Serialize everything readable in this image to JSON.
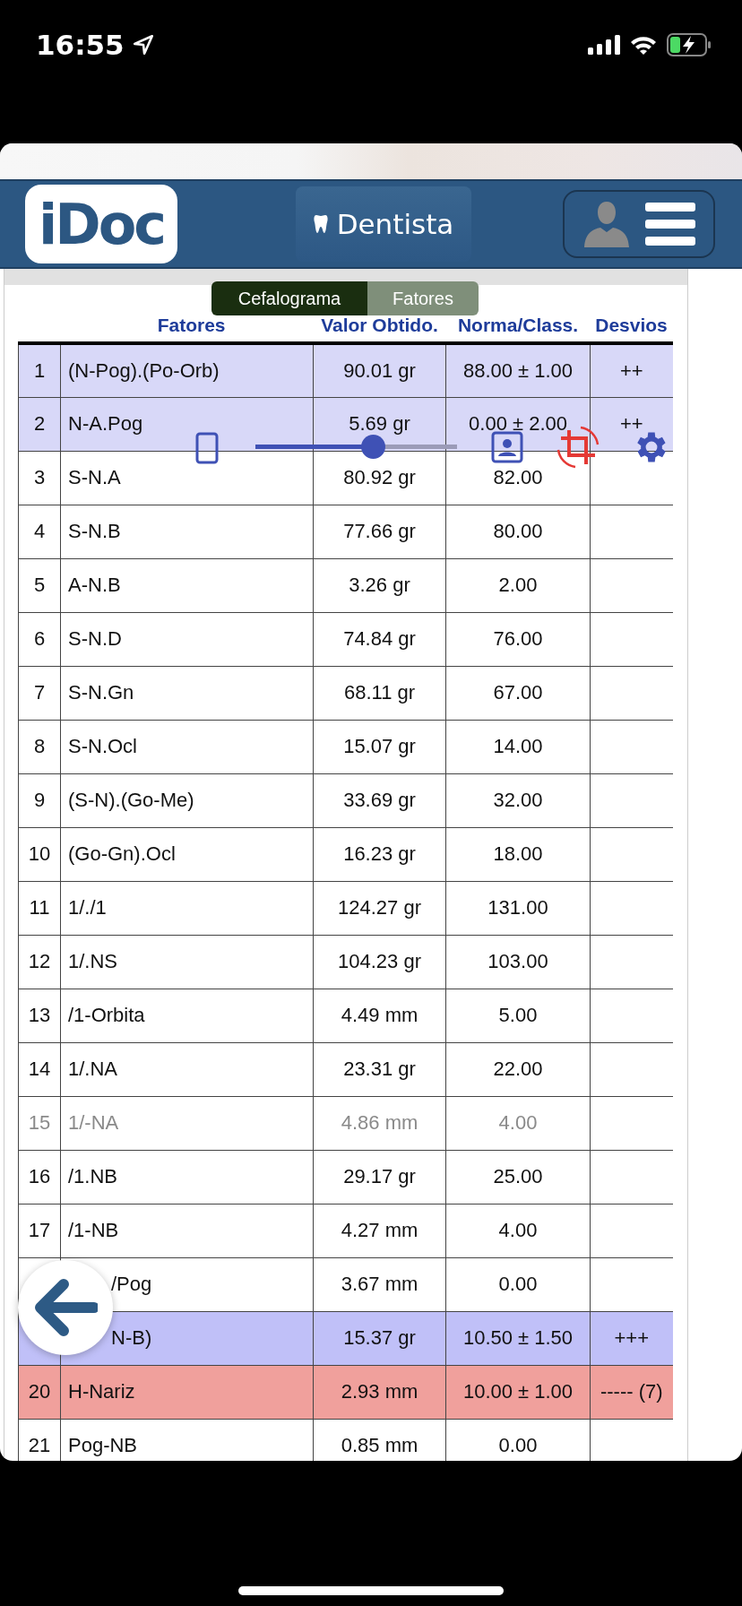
{
  "status_bar": {
    "time": "16:55"
  },
  "header": {
    "logo": "iDoc",
    "mode_button": "Dentista"
  },
  "view_toggle": [
    {
      "label": "Cefalograma",
      "selected": true
    },
    {
      "label": "Fatores",
      "selected": false
    }
  ],
  "zoom_slider": {
    "level": 0.58
  },
  "table": {
    "columns": [
      "Fatores",
      "Valor Obtido.",
      "Norma/Class.",
      "Desvios"
    ],
    "rows": [
      {
        "num": "1",
        "factor": "(N-Pog).(Po-Orb)",
        "value": "90.01 gr",
        "norm": "88.00 ± 1.00",
        "deviation": "++",
        "color": "#d8d8f8",
        "disabled": false
      },
      {
        "num": "2",
        "factor": "N-A.Pog",
        "value": "5.69 gr",
        "norm": "0.00 ± 2.00",
        "deviation": "++",
        "color": "#d8d8f8",
        "disabled": false
      },
      {
        "num": "3",
        "factor": "S-N.A",
        "value": "80.92 gr",
        "norm": "82.00",
        "disabled": false
      },
      {
        "num": "4",
        "factor": "S-N.B",
        "value": "77.66 gr",
        "norm": "80.00",
        "disabled": false
      },
      {
        "num": "5",
        "factor": "A-N.B",
        "value": "3.26 gr",
        "norm": "2.00",
        "disabled": false
      },
      {
        "num": "6",
        "factor": "S-N.D",
        "value": "74.84 gr",
        "norm": "76.00",
        "disabled": false
      },
      {
        "num": "7",
        "factor": "S-N.Gn",
        "value": "68.11 gr",
        "norm": "67.00",
        "disabled": false
      },
      {
        "num": "8",
        "factor": "S-N.Ocl",
        "value": "15.07 gr",
        "norm": "14.00",
        "disabled": false
      },
      {
        "num": "9",
        "factor": "(S-N).(Go-Me)",
        "value": "33.69 gr",
        "norm": "32.00",
        "disabled": false
      },
      {
        "num": "10",
        "factor": "(Go-Gn).Ocl",
        "value": "16.23 gr",
        "norm": "18.00",
        "disabled": false
      },
      {
        "num": "11",
        "factor": "1/./1",
        "value": "124.27 gr",
        "norm": "131.00",
        "disabled": false
      },
      {
        "num": "12",
        "factor": "1/.NS",
        "value": "104.23 gr",
        "norm": "103.00",
        "disabled": false
      },
      {
        "num": "13",
        "factor": "/1-Orbita",
        "value": "4.49 mm",
        "norm": "5.00",
        "disabled": false
      },
      {
        "num": "14",
        "factor": "1/.NA",
        "value": "23.31 gr",
        "norm": "22.00",
        "disabled": false
      },
      {
        "num": "15",
        "factor": "1/-NA",
        "value": "4.86 mm",
        "norm": "4.00",
        "disabled": true
      },
      {
        "num": "16",
        "factor": "/1.NB",
        "value": "29.17 gr",
        "norm": "25.00",
        "disabled": false
      },
      {
        "num": "17",
        "factor": "/1-NB",
        "value": "4.27 mm",
        "norm": "4.00",
        "disabled": false
      },
      {
        "factor": "/Pog",
        "value": "3.67 mm",
        "norm": "0.00",
        "disabled": false
      },
      {
        "factor": "N-B)",
        "value": "15.37 gr",
        "norm": "10.50 ± 1.50",
        "deviation": "+++",
        "color": "#c0c0f8",
        "disabled": false
      },
      {
        "num": "20",
        "factor": "H-Nariz",
        "value": "2.93 mm",
        "norm": "10.00 ± 1.00",
        "deviation": "----- (7)",
        "color": "#f0a09c",
        "disabled": false
      },
      {
        "num": "21",
        "factor": "Pog-NB",
        "value": "0.85 mm",
        "norm": "0.00",
        "disabled": false
      }
    ]
  }
}
